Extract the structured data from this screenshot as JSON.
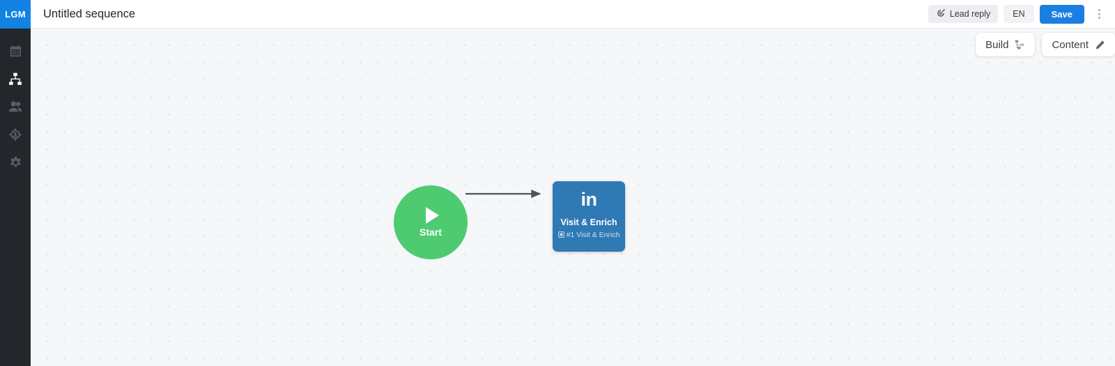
{
  "sidebar": {
    "logo_text": "LGM",
    "items": [
      {
        "name": "calendar",
        "icon": "calendar-icon",
        "active": false
      },
      {
        "name": "sequences",
        "icon": "sitemap-icon",
        "active": true
      },
      {
        "name": "contacts",
        "icon": "people-icon",
        "active": false
      },
      {
        "name": "targeting",
        "icon": "target-person-icon",
        "active": false
      },
      {
        "name": "settings",
        "icon": "gear-icon",
        "active": false
      }
    ]
  },
  "topbar": {
    "title": "Untitled sequence",
    "lead_reply_label": "Lead reply",
    "lead_reply_icon": "target-arrow-icon",
    "language_label": "EN",
    "save_label": "Save",
    "more_icon": "kebab-menu-icon"
  },
  "canvas": {
    "toggles": [
      {
        "label": "Build",
        "icon": "sitemap-icon"
      },
      {
        "label": "Content",
        "icon": "pencil-icon"
      }
    ]
  },
  "flow": {
    "start_node": {
      "label": "Start",
      "icon": "play-icon",
      "color": "#4ecb71"
    },
    "action_node": {
      "brand_icon": "linkedin-in-icon",
      "title": "Visit & Enrich",
      "subtitle": "#1 Visit & Enrich",
      "subtitle_icon": "step-badge-icon",
      "color": "#2f79b5"
    },
    "connector": {
      "from": "start_node",
      "to": "action_node",
      "arrow": true,
      "color": "#4d535c"
    }
  },
  "colors": {
    "brand_blue": "#1283e2",
    "save_blue": "#1a7fe0",
    "sidebar_dark": "#23262b",
    "canvas_bg": "#f6f7f9",
    "green": "#4ecb71",
    "linkedin_blue": "#2f79b5"
  }
}
